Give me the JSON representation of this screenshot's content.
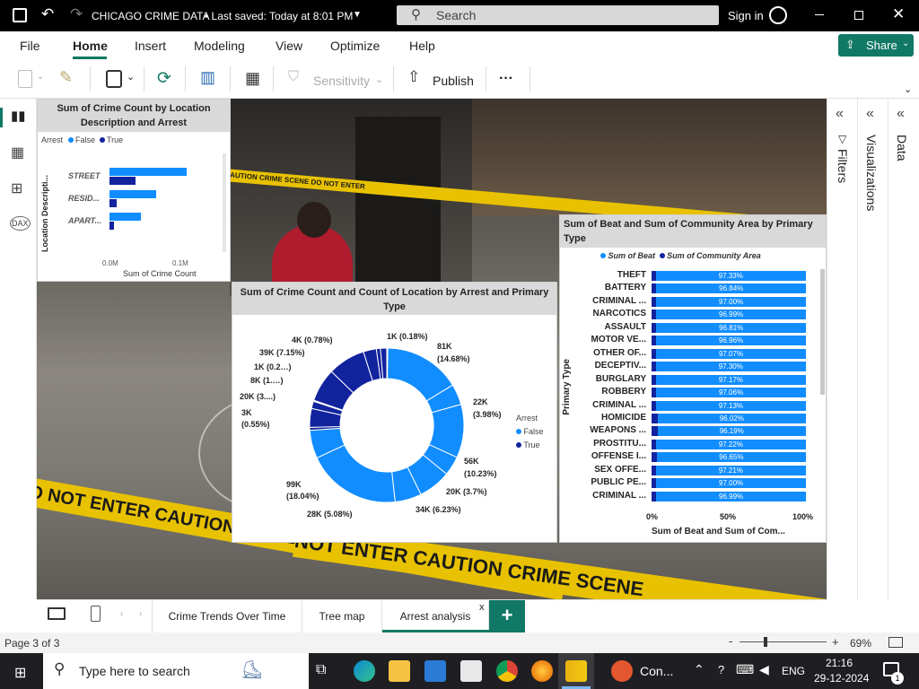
{
  "window": {
    "title": "CHICAGO CRIME DATA",
    "saved": "• Last saved: Today at 8:01 PM",
    "search_placeholder": "Search",
    "sign_in": "Sign in"
  },
  "menu": [
    "File",
    "Home",
    "Insert",
    "Modeling",
    "View",
    "Optimize",
    "Help"
  ],
  "share_label": "Share",
  "ribbon": {
    "sensitivity": "Sensitivity",
    "publish": "Publish",
    "more": "···"
  },
  "panes": {
    "filters": "Filters",
    "visualizations": "Visualizations",
    "data": "Data"
  },
  "tape_texts": [
    "CAUTION CRIME SCENE DO NOT ENTER",
    "DO NOT ENTER CAUTION CRIME SCENE",
    "NOT ENTER   CAUTION CRIME SCENE"
  ],
  "chart1": {
    "title": "Sum of Crime Count by Location Description and Arrest",
    "legend_title": "Arrest",
    "legend": [
      "False",
      "True"
    ],
    "ylabel": "Location Descripti...",
    "xlabel": "Sum of Crime Count",
    "ticks": [
      "0.0M",
      "0.1M"
    ]
  },
  "chart2": {
    "title": "Sum of Crime Count and Count of Location by Arrest and Primary Type",
    "legend_title": "Arrest",
    "legend": [
      "False",
      "True"
    ],
    "labels": [
      "1K (0.18%)",
      "81K",
      "(14.68%)",
      "22K",
      "(3.98%)",
      "56K",
      "(10.23%)",
      "20K (3.7%)",
      "34K (6.23%)",
      "28K (5.08%)",
      "99K",
      "(18.04%)",
      "3K",
      "(0.55%)",
      "20K (3....)",
      "8K (1.…)",
      "1K (0.2…)",
      "39K (7.15%)",
      "4K (0.78%)"
    ]
  },
  "chart3": {
    "title": "Sum of Beat and Sum of Community Area by Primary Type",
    "legend": [
      "Sum of Beat",
      "Sum of Community Area"
    ],
    "ylabel": "Primary Type",
    "xlabel": "Sum of Beat and Sum of Com...",
    "ticks": [
      "0%",
      "50%",
      "100%"
    ]
  },
  "chart_data": [
    {
      "type": "bar",
      "orientation": "horizontal",
      "title": "Sum of Crime Count by Location Description and Arrest",
      "xlabel": "Sum of Crime Count",
      "ylabel": "Location Descripti...",
      "categories": [
        "STREET",
        "RESID...",
        "APART..."
      ],
      "series": [
        {
          "name": "False",
          "values": [
            0.135,
            0.082,
            0.054
          ]
        },
        {
          "name": "True",
          "values": [
            0.046,
            0.013,
            0.008
          ]
        }
      ],
      "xlim": [
        0,
        0.18
      ],
      "legend": "top-left"
    },
    {
      "type": "pie",
      "title": "Sum of Crime Count and Count of Location by Arrest and Primary Type",
      "slices": [
        {
          "arrest": "False",
          "label": "1K (0.18%)",
          "value": 0.18
        },
        {
          "arrest": "False",
          "label": "81K (14.68%)",
          "value": 14.68
        },
        {
          "arrest": "False",
          "label": "22K (3.98%)",
          "value": 3.98
        },
        {
          "arrest": "False",
          "label": "56K (10.23%)",
          "value": 10.23
        },
        {
          "arrest": "False",
          "label": "20K (3.7%)",
          "value": 3.7
        },
        {
          "arrest": "False",
          "label": "34K (6.23%)",
          "value": 6.23
        },
        {
          "arrest": "False",
          "label": "28K (5.08%)",
          "value": 5.08
        },
        {
          "arrest": "False",
          "label": "99K (18.04%)",
          "value": 18.04
        },
        {
          "arrest": "False",
          "label": "",
          "value": 5.4
        },
        {
          "arrest": "True",
          "label": "3K (0.55%)",
          "value": 0.55
        },
        {
          "arrest": "True",
          "label": "20K (3....)",
          "value": 3.6
        },
        {
          "arrest": "True",
          "label": "8K (1.…)",
          "value": 1.4
        },
        {
          "arrest": "True",
          "label": "1K (0.2…)",
          "value": 0.2
        },
        {
          "arrest": "True",
          "label": "",
          "value": 6.4
        },
        {
          "arrest": "True",
          "label": "39K (7.15%)",
          "value": 7.15
        },
        {
          "arrest": "True",
          "label": "",
          "value": 2.5
        },
        {
          "arrest": "True",
          "label": "4K (0.78%)",
          "value": 0.78
        },
        {
          "arrest": "True",
          "label": "",
          "value": 1.2
        }
      ],
      "hole": true,
      "legend": "right"
    },
    {
      "type": "bar",
      "orientation": "horizontal",
      "stacked_percent": true,
      "title": "Sum of Beat and Sum of Community Area by Primary Type",
      "ylabel": "Primary Type",
      "xlabel": "Sum of Beat and Sum of Com...",
      "categories": [
        "THEFT",
        "BATTERY",
        "CRIMINAL ...",
        "NARCOTICS",
        "ASSAULT",
        "MOTOR VE...",
        "OTHER OF...",
        "DECEPTIV...",
        "BURGLARY",
        "ROBBERY",
        "CRIMINAL ...",
        "HOMICIDE",
        "WEAPONS ...",
        "PROSTITU...",
        "OFFENSE I...",
        "SEX OFFE...",
        "PUBLIC PE...",
        "CRIMINAL ..."
      ],
      "series": [
        {
          "name": "Sum of Beat",
          "values": [
            97.33,
            96.84,
            97.0,
            96.99,
            96.81,
            96.96,
            97.07,
            97.3,
            97.17,
            97.06,
            97.13,
            96.02,
            96.19,
            97.22,
            96.65,
            97.21,
            97.0,
            96.99
          ]
        },
        {
          "name": "Sum of Community Area",
          "values": [
            2.67,
            3.16,
            3.0,
            3.01,
            3.19,
            3.04,
            2.93,
            2.7,
            2.83,
            2.94,
            2.87,
            3.98,
            3.81,
            2.78,
            3.35,
            2.79,
            3.0,
            3.01
          ]
        }
      ],
      "data_labels": [
        "97.33%",
        "96.84%",
        "97.00%",
        "96.99%",
        "96.81%",
        "96.96%",
        "97.07%",
        "97.30%",
        "97.17%",
        "97.06%",
        "97.13%",
        "96.02%",
        "96.19%",
        "97.22%",
        "96.65%",
        "97.21%",
        "97.00%",
        "96.99%"
      ],
      "xlim": [
        0,
        100
      ],
      "legend": "top"
    }
  ],
  "pages": [
    "Crime Trends Over Time",
    "Tree map",
    "Arrest analysis"
  ],
  "status": {
    "page": "Page 3 of 3",
    "zoom": "69%"
  },
  "taskbar": {
    "search_placeholder": "Type here to search",
    "app_label": "Con...",
    "lang": "ENG",
    "time": "21:16",
    "date": "29-12-2024",
    "notif": "1"
  },
  "colors": {
    "false": "#118dff",
    "true": "#12239e",
    "tape": "#e8c200",
    "accent_share": "#117865"
  }
}
